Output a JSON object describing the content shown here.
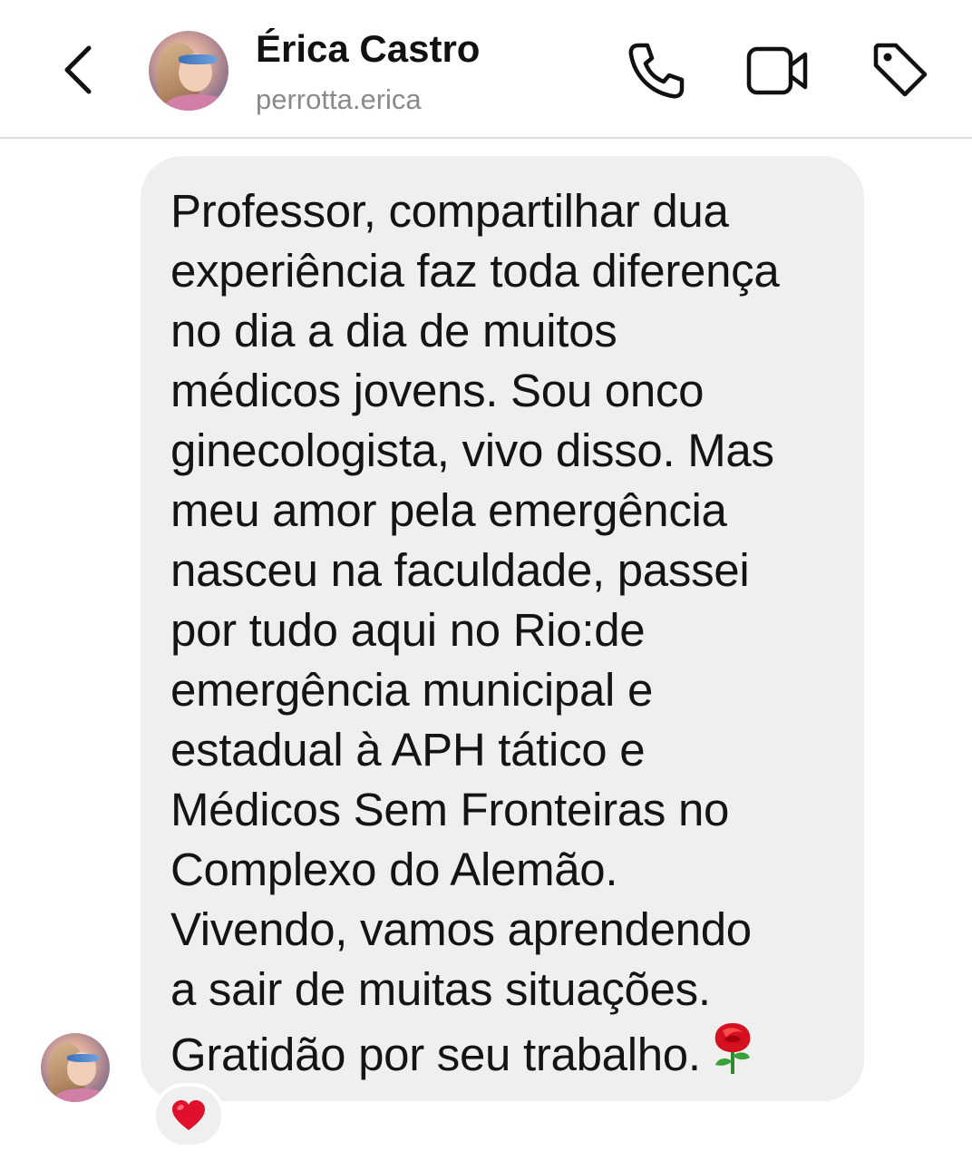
{
  "header": {
    "back_icon": "chevron-left-icon",
    "contact_name": "Érica Castro",
    "contact_username": "perrotta.erica",
    "actions": [
      {
        "name": "phone-call",
        "icon": "phone-icon"
      },
      {
        "name": "video-call",
        "icon": "video-camera-icon"
      },
      {
        "name": "tag",
        "icon": "tag-icon"
      }
    ]
  },
  "message": {
    "text": "Professor, compartilhar dua\nexperiência faz toda diferença\nno dia a dia de muitos\nmédicos jovens.  Sou onco\nginecologista, vivo disso. Mas\nmeu amor pela emergência\nnasceu na faculdade, passei\npor tudo aqui no Rio:de\nemergência municipal e\nestadual à APH tático e\nMédicos Sem Fronteiras no\nComplexo do Alemão.\nVivendo, vamos aprendendo\na sair de muitas situações.\nGratidão por seu trabalho.",
    "trailing_emoji": "rose-emoji",
    "reaction": "red-heart-emoji"
  },
  "colors": {
    "bubble_background": "#efefef",
    "username_gray": "#8a8a8a",
    "heart_red": "#e0102c",
    "divider": "#dcdcdc"
  }
}
